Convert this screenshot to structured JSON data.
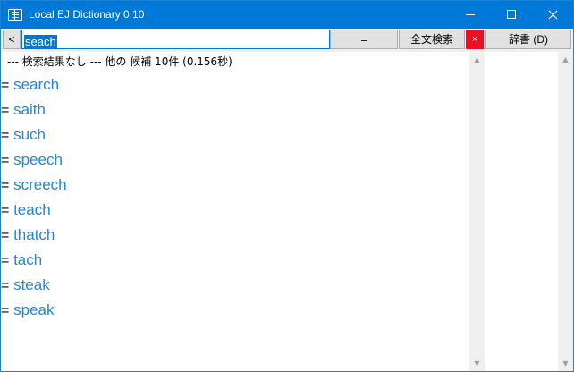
{
  "window": {
    "title": "Local EJ Dictionary 0.10"
  },
  "toolbar": {
    "back_label": "<",
    "search_value": "seach",
    "equal_label": "=",
    "fulltext_label": "全文検索",
    "clear_label": "×",
    "dict_label": "辞書 (D)"
  },
  "results": {
    "status": "--- 検索結果なし ---   他の 候補 10件 (0.156秒)",
    "candidate_prefix": "=",
    "candidates": [
      "search",
      "saith",
      "such",
      "speech",
      "screech",
      "teach",
      "thatch",
      "tach",
      "steak",
      "speak"
    ]
  },
  "colors": {
    "accent": "#0078d7",
    "link": "#1e88e5",
    "close": "#e81123"
  }
}
